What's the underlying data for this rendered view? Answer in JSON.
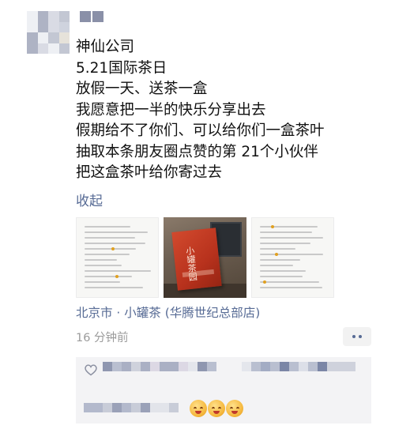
{
  "post": {
    "lines": [
      "神仙公司",
      "5.21国际茶日",
      "放假一天、送茶一盒",
      "我愿意把一半的快乐分享出去",
      "假期给不了你们、可以给你们一盒茶叶",
      "抽取本条朋友圈点赞的第 21个小伙伴",
      "把这盒茶叶给你寄过去"
    ],
    "collapse_label": "收起",
    "location": "北京市 · 小罐茶 (华腾世纪总部店)",
    "time": "16 分钟前"
  },
  "photos": [
    {
      "kind": "text-document",
      "icon": "document-thumbnail"
    },
    {
      "kind": "tea-box-on-desk",
      "box_text": "小罐茶园",
      "icon": "tea-box-photo"
    },
    {
      "kind": "text-document",
      "icon": "document-thumbnail"
    }
  ],
  "colors": {
    "link": "#576b95",
    "meta_gray": "#9b9b9b",
    "panel_bg": "#f3f3f5"
  },
  "icons": {
    "more": "more-dots-icon",
    "like": "heart-outline-icon",
    "comment_emoji": "sun-face-emoji-icon"
  }
}
